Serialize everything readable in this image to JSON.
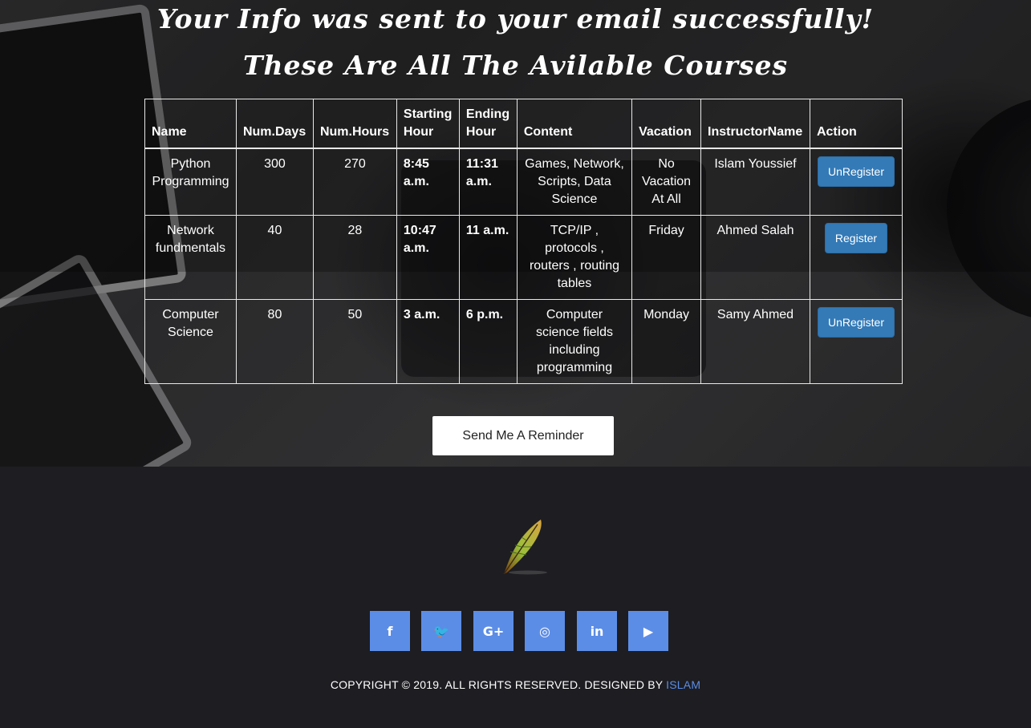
{
  "header": {
    "success_message": "Your Info was sent to your email successfully!",
    "courses_title": "These Are All The Avilable Courses"
  },
  "table": {
    "columns": [
      "Name",
      "Num.Days",
      "Num.Hours",
      "Starting Hour",
      "Ending Hour",
      "Content",
      "Vacation",
      "InstructorName",
      "Action"
    ],
    "rows": [
      {
        "name": "Python Programming",
        "days": "300",
        "hours": "270",
        "start": "8:45 a.m.",
        "end": "11:31 a.m.",
        "content": "Games, Network, Scripts, Data Science",
        "vacation": "No Vacation At All",
        "instructor": "Islam Youssief",
        "action": "UnRegister"
      },
      {
        "name": "Network fundmentals",
        "days": "40",
        "hours": "28",
        "start": "10:47 a.m.",
        "end": "11 a.m.",
        "content": "TCP/IP , protocols , routers , routing tables",
        "vacation": "Friday",
        "instructor": "Ahmed Salah",
        "action": "Register"
      },
      {
        "name": "Computer Science",
        "days": "80",
        "hours": "50",
        "start": "3 a.m.",
        "end": "6 p.m.",
        "content": "Computer science fields including programming",
        "vacation": "Monday",
        "instructor": "Samy Ahmed",
        "action": "UnRegister"
      }
    ]
  },
  "reminder_button": "Send Me A Reminder",
  "footer": {
    "social": [
      {
        "name": "facebook-icon",
        "glyph": "f"
      },
      {
        "name": "twitter-icon",
        "glyph": "🐦"
      },
      {
        "name": "google-plus-icon",
        "glyph": "G+"
      },
      {
        "name": "instagram-icon",
        "glyph": "◎"
      },
      {
        "name": "linkedin-icon",
        "glyph": "in"
      },
      {
        "name": "youtube-icon",
        "glyph": "▶"
      }
    ],
    "copyright": "COPYRIGHT © 2019. ALL RIGHTS RESERVED. DESIGNED BY",
    "designer": "ISLAM",
    "accent_color": "#5c8de6"
  }
}
